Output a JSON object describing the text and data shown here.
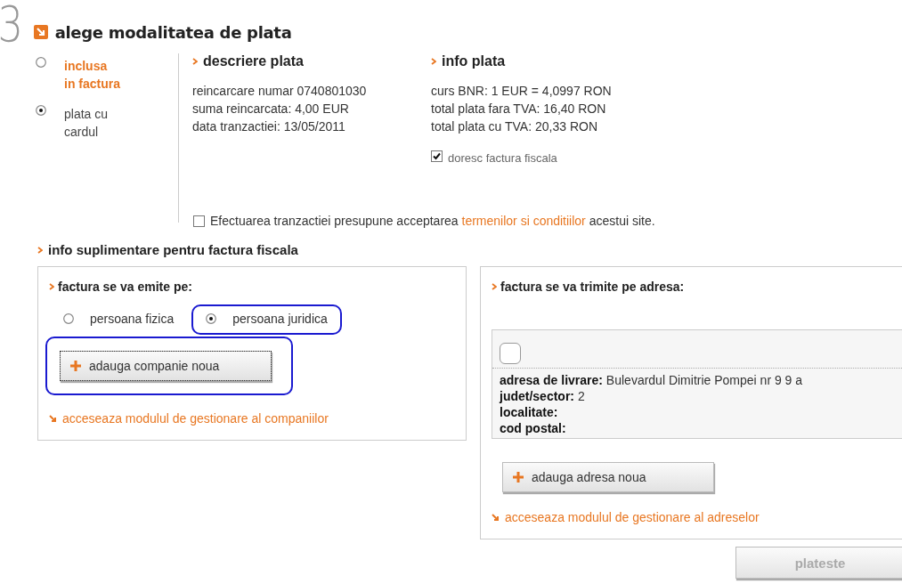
{
  "step": {
    "number": "3",
    "title": "alege modalitatea de plata"
  },
  "payment_methods": [
    {
      "label": "inclusa\nin factura",
      "selected": false,
      "emphasized": true
    },
    {
      "label": "plata cu\ncardul",
      "selected": true,
      "emphasized": false
    }
  ],
  "description": {
    "heading": "descriere plata",
    "lines": [
      "reincarcare numar 0740801030",
      "suma reincarcata: 4,00 EUR",
      "data tranzactiei: 13/05/2011"
    ]
  },
  "info": {
    "heading": "info plata",
    "lines": [
      "curs BNR: 1 EUR = 4,0997 RON",
      "total plata fara TVA: 16,40 RON",
      "total plata cu TVA: 20,33 RON"
    ],
    "invoice_checkbox": {
      "label": "doresc factura fiscala",
      "checked": true
    }
  },
  "terms": {
    "checked": false,
    "before": "Efectuarea tranzactiei presupune acceptarea ",
    "link": "termenilor si conditiilor",
    "after": " acestui site."
  },
  "extra_section": {
    "heading": "info suplimentare pentru factura fiscala",
    "invoice_to": {
      "heading": "factura se va emite pe:",
      "options": [
        {
          "label": "persoana fizica",
          "selected": false,
          "highlighted": false
        },
        {
          "label": "persoana juridica",
          "selected": true,
          "highlighted": true
        }
      ],
      "add_button": {
        "label": "adauga companie noua",
        "highlighted": true,
        "focused": true
      },
      "manage_link": "acceseaza modulul de gestionare al companiilor"
    },
    "address": {
      "heading": "factura se va trimite pe adresa:",
      "card": {
        "selected": false,
        "fields": [
          {
            "label": "adresa de livrare:",
            "value": "Bulevardul Dimitrie Pompei nr 9 9 a"
          },
          {
            "label": "judet/sector:",
            "value": "2"
          },
          {
            "label": "localitate:"
          },
          {
            "label": "cod postal:"
          }
        ]
      },
      "add_button": {
        "label": "adauga adresa noua",
        "highlighted": false,
        "focused": false
      },
      "manage_link": "acceseaza modulul de gestionare al adreselor"
    }
  },
  "pay_button": {
    "label": "plateste",
    "disabled": true
  }
}
